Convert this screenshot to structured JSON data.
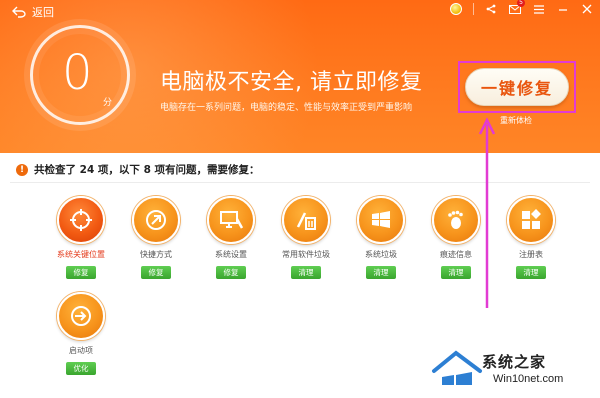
{
  "header": {
    "back_label": "返回",
    "score": "0",
    "score_unit": "分",
    "headline": "电脑极不安全, 请立即修复",
    "subline": "电脑存在一系列问题，电脑的稳定、性能与效率正受到严重影响",
    "fix_button": "一键修复",
    "recheck": "重新体检",
    "mail_badge": "5"
  },
  "summary": {
    "text": "共检查了 24 项，以下 8 项有问题，需要修复："
  },
  "items": [
    {
      "label": "系统关键位置",
      "action": "修复"
    },
    {
      "label": "快捷方式",
      "action": "修复"
    },
    {
      "label": "系统设置",
      "action": "修复"
    },
    {
      "label": "常用软件垃圾",
      "action": "清理"
    },
    {
      "label": "系统垃圾",
      "action": "清理"
    },
    {
      "label": "痕迹信息",
      "action": "清理"
    },
    {
      "label": "注册表",
      "action": "清理"
    },
    {
      "label": "启动项",
      "action": "优化"
    }
  ],
  "watermark": {
    "title": "系统之家",
    "url": "Win10net.com"
  },
  "colors": {
    "accent": "#ff7a1f",
    "button_green": "#3aa52e",
    "annotation": "#e23bd3",
    "warning_red": "#e43b1c"
  }
}
